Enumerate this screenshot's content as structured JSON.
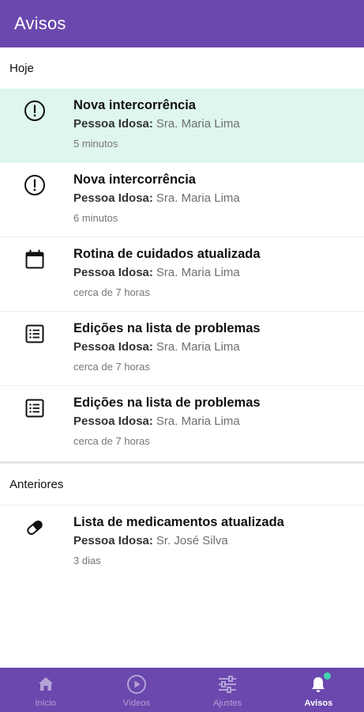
{
  "appbar": {
    "title": "Avisos"
  },
  "sections": {
    "today": {
      "header": "Hoje",
      "items": [
        {
          "icon": "alert-circle-icon",
          "title": "Nova intercorrência",
          "label": "Pessoa Idosa:",
          "value": "Sra. Maria Lima",
          "time": "5 minutos",
          "highlighted": true
        },
        {
          "icon": "alert-circle-icon",
          "title": "Nova intercorrência",
          "label": "Pessoa Idosa:",
          "value": "Sra. Maria Lima",
          "time": "6 minutos",
          "highlighted": false
        },
        {
          "icon": "calendar-icon",
          "title": "Rotina de cuidados atualizada",
          "label": "Pessoa Idosa:",
          "value": "Sra. Maria Lima",
          "time": "cerca de 7 horas",
          "highlighted": false
        },
        {
          "icon": "list-icon",
          "title": "Edições na lista de problemas",
          "label": "Pessoa Idosa:",
          "value": "Sra. Maria Lima",
          "time": "cerca de 7 horas",
          "highlighted": false
        },
        {
          "icon": "list-icon",
          "title": "Edições na lista de problemas",
          "label": "Pessoa Idosa:",
          "value": "Sra. Maria Lima",
          "time": "cerca de 7 horas",
          "highlighted": false
        }
      ]
    },
    "earlier": {
      "header": "Anteriores",
      "items": [
        {
          "icon": "pill-icon",
          "title": "Lista de medicamentos atualizada",
          "label": "Pessoa Idosa:",
          "value": "Sr. José Silva",
          "time": "3 dias",
          "highlighted": false
        }
      ]
    }
  },
  "bottom_nav": {
    "items": [
      {
        "icon": "home-icon",
        "label": "Início",
        "active": false
      },
      {
        "icon": "play-circle-icon",
        "label": "Vídeos",
        "active": false
      },
      {
        "icon": "sliders-icon",
        "label": "Ajustes",
        "active": false
      },
      {
        "icon": "bell-icon",
        "label": "Avisos",
        "active": true
      }
    ]
  },
  "colors": {
    "primary": "#6a48ad",
    "highlight": "#def6ee",
    "badge": "#41d6b0"
  }
}
